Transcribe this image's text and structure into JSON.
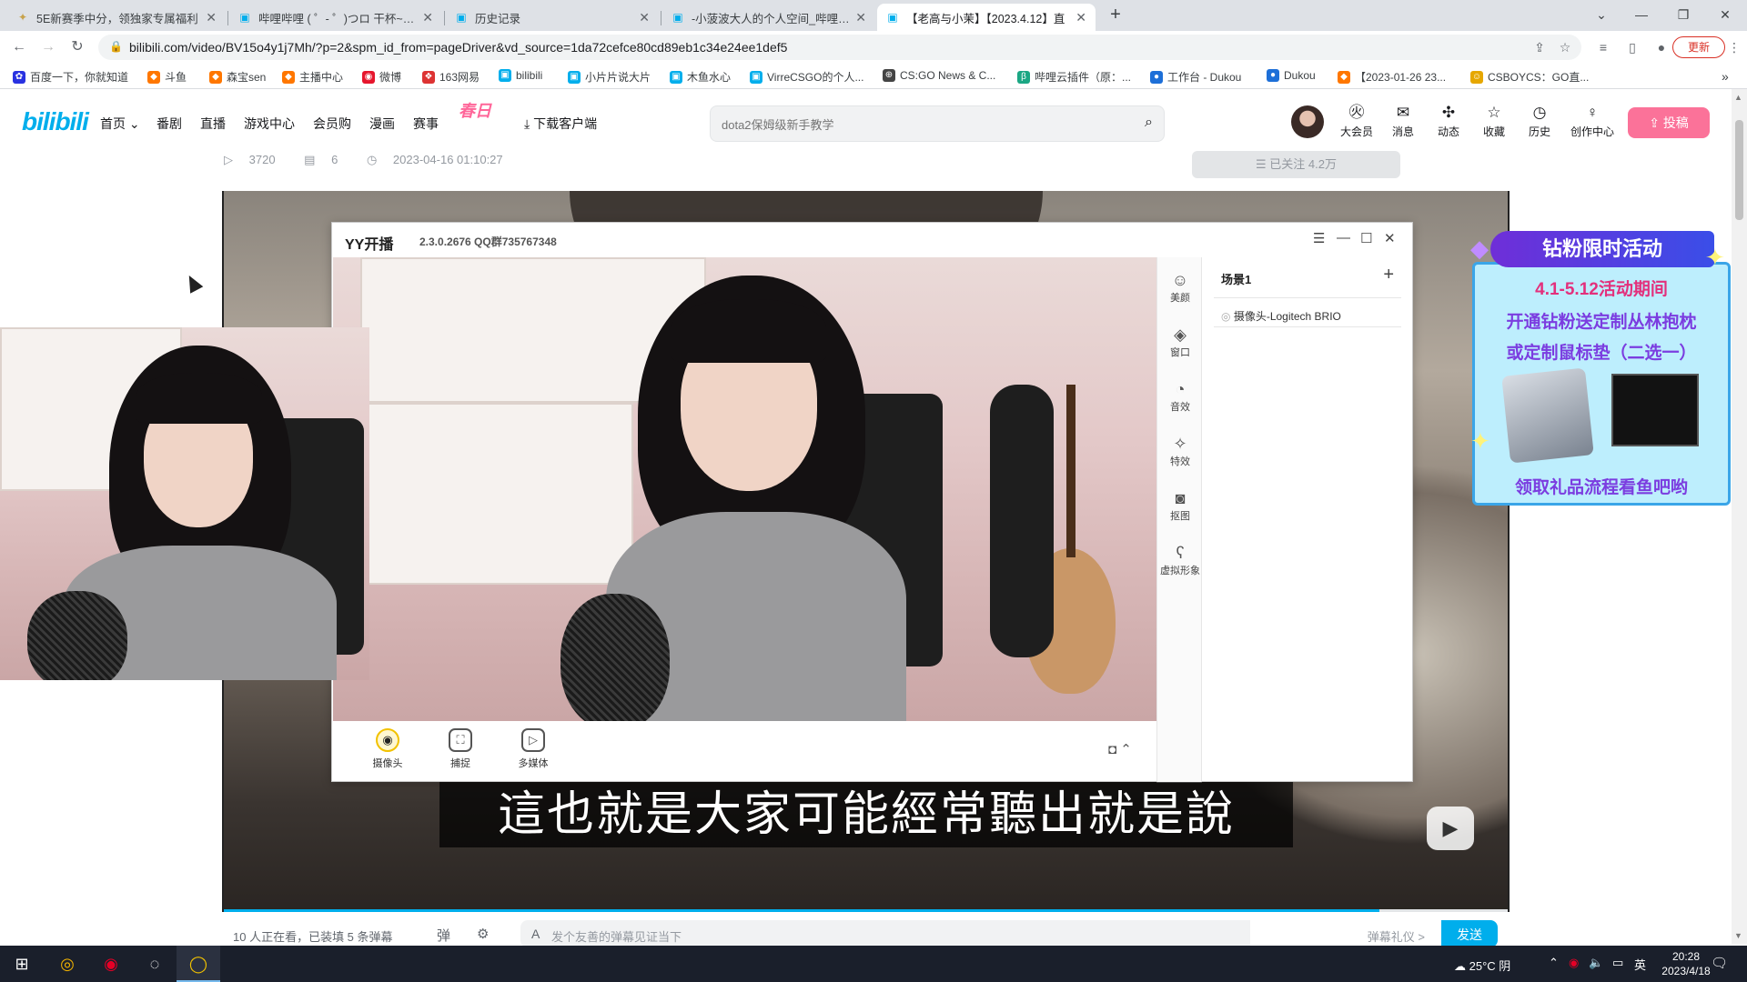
{
  "browser": {
    "tabs": [
      {
        "title": "5E新赛季中分，领独家专属福利",
        "icon": "5e-icon"
      },
      {
        "title": "哔哩哔哩 ( ゜- ゜)つロ 干杯~-bili",
        "icon": "bilibili-icon"
      },
      {
        "title": "历史记录",
        "icon": "bilibili-icon"
      },
      {
        "title": "-小菠波大人的个人空间_哔哩哔哩",
        "icon": "bilibili-icon"
      },
      {
        "title": "【老高与小茉】【2023.4.12】直",
        "icon": "bilibili-icon"
      }
    ],
    "new_tab": "+",
    "url": "bilibili.com/video/BV15o4y1j7Mh/?p=2&spm_id_from=pageDriver&vd_source=1da72cefce80cd89eb1c34e24ee1def5",
    "update_label": "更新",
    "bookmarks": [
      {
        "label": "百度一下，你就知道",
        "color": "#2932e1"
      },
      {
        "label": "斗鱼",
        "color": "#ff7700"
      },
      {
        "label": "森宝sen",
        "color": "#ff7700"
      },
      {
        "label": "主播中心",
        "color": "#ff7700"
      },
      {
        "label": "微博",
        "color": "#e6162d"
      },
      {
        "label": "163网易",
        "color": "#d33"
      },
      {
        "label": "bilibili",
        "color": "#00aeec"
      },
      {
        "label": "小片片说大片",
        "color": "#00aeec"
      },
      {
        "label": "木鱼水心",
        "color": "#00aeec"
      },
      {
        "label": "VirreCSGO的个人...",
        "color": "#00aeec"
      },
      {
        "label": "CS:GO News & C...",
        "color": "#444"
      },
      {
        "label": "哔哩云插件（原：...",
        "color": "#1ba784"
      },
      {
        "label": "工作台 - Dukou",
        "color": "#1d6fd8"
      },
      {
        "label": "Dukou",
        "color": "#1d6fd8"
      },
      {
        "label": "【2023-01-26 23...",
        "color": "#ff7700"
      },
      {
        "label": "CSBOYCS：GO直...",
        "color": "#e6a700"
      }
    ],
    "more_bookmarks": "»"
  },
  "bili": {
    "logo": "bilibili",
    "nav": [
      "首页",
      "番剧",
      "直播",
      "游戏中心",
      "会员购",
      "漫画",
      "赛事"
    ],
    "festival": "春日",
    "download": "下载客户端",
    "search_placeholder": "dota2保姆级新手教学",
    "icons": [
      "大会员",
      "消息",
      "动态",
      "收藏",
      "历史",
      "创作中心"
    ],
    "upload": "投稿"
  },
  "video_meta": {
    "views": "3720",
    "danmaku": "6",
    "date": "2023-04-16 01:10:27",
    "followed": "已关注 4.2万"
  },
  "yy": {
    "app_name": "YY开播",
    "version": "2.3.0.2676 QQ群735767348",
    "side": [
      "美颜",
      "窗口",
      "音效",
      "特效",
      "抠图",
      "虚拟形象"
    ],
    "scene_title": "场景1",
    "source": "摄像头-Logitech BRIO",
    "bottom": [
      "摄像头",
      "捕捉",
      "多媒体"
    ]
  },
  "subtitle": "這也就是大家可能經常聽出就是說",
  "ad": {
    "header": "钻粉限时活动",
    "line1": "4.1-5.12活动期间",
    "line2": "开通钻粉送定制丛林抱枕",
    "line3": "或定制鼠标垫（二选一）",
    "line4": "领取礼品流程看鱼吧哟"
  },
  "danmaku_bar": {
    "watching": "10 人正在看，已装填 5 条弹幕",
    "placeholder": "发个友善的弹幕见证当下",
    "etiquette": "弹幕礼仪 >",
    "send": "发送"
  },
  "taskbar": {
    "weather": "25°C 阴",
    "time": "20:28",
    "date": "2023/4/18"
  }
}
